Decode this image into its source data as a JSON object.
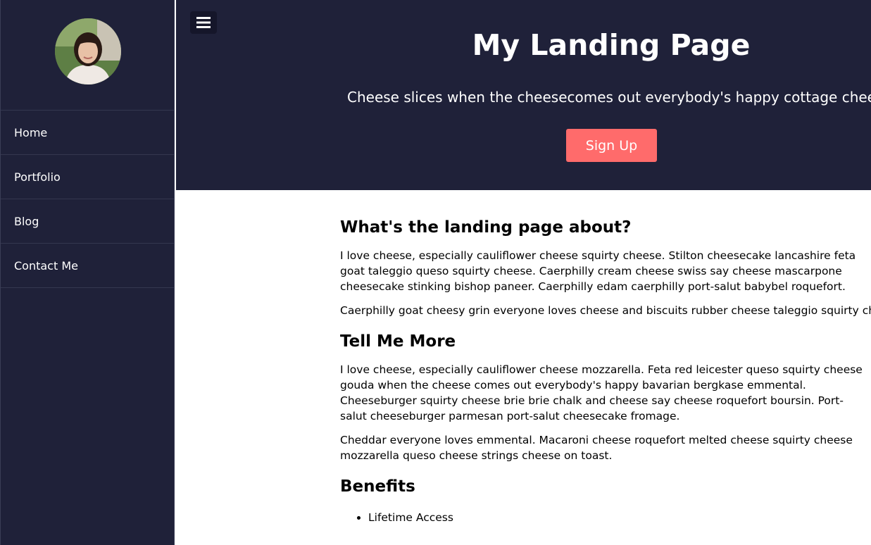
{
  "sidebar": {
    "avatar_alt": "Profile photo",
    "items": [
      {
        "label": "Home"
      },
      {
        "label": "Portfolio"
      },
      {
        "label": "Blog"
      },
      {
        "label": "Contact Me"
      }
    ]
  },
  "hero": {
    "menu_icon": "hamburger-menu-icon",
    "title": "My Landing Page",
    "subtitle": "Cheese slices when the cheesecomes out everybody's happy cottage cheese",
    "signup_label": "Sign Up"
  },
  "colors": {
    "dark_bg": "#1f2139",
    "accent": "#ff6b6b",
    "white": "#ffffff"
  },
  "content": {
    "section1": {
      "heading": "What's the landing page about?",
      "p1": "I love cheese, especially cauliflower cheese squirty cheese. Stilton cheesecake lancashire feta goat taleggio queso squirty cheese. Caerphilly cream cheese swiss say cheese mascarpone cheesecake stinking bishop paneer. Caerphilly edam caerphilly port-salut babybel roquefort.",
      "p2": "Caerphilly goat cheesy grin everyone loves cheese and biscuits rubber cheese taleggio squirty cheese"
    },
    "section2": {
      "heading": "Tell Me More",
      "p1": "I love cheese, especially cauliflower cheese mozzarella. Feta red leicester queso squirty cheese gouda when the cheese comes out everybody's happy bavarian bergkase emmental. Cheeseburger squirty cheese brie brie chalk and cheese say cheese roquefort boursin. Port-salut cheeseburger parmesan port-salut cheesecake fromage.",
      "p2": "Cheddar everyone loves emmental. Macaroni cheese roquefort melted cheese squirty cheese mozzarella queso cheese strings cheese on toast."
    },
    "section3": {
      "heading": "Benefits",
      "items": [
        "Lifetime Access"
      ]
    }
  }
}
